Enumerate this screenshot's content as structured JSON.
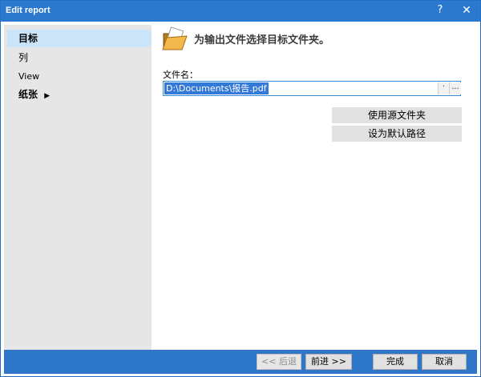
{
  "window": {
    "title": "Edit report",
    "help": "?",
    "close": "✕"
  },
  "sidebar": {
    "items": [
      {
        "label": "目标"
      },
      {
        "label": "列"
      },
      {
        "label": "View"
      },
      {
        "label": "纸张"
      }
    ]
  },
  "main": {
    "header": "为输出文件选择目标文件夹。",
    "file_label": "文件名：",
    "file_value": "D:\\Documents\\报告.pdf",
    "dot_label": "·",
    "browse_label": "...",
    "use_source_folder": "使用源文件夹",
    "set_default_path": "设为默认路径"
  },
  "footer": {
    "back": "<< 后退",
    "next": "前进 >>",
    "finish": "完成",
    "cancel": "取消"
  }
}
